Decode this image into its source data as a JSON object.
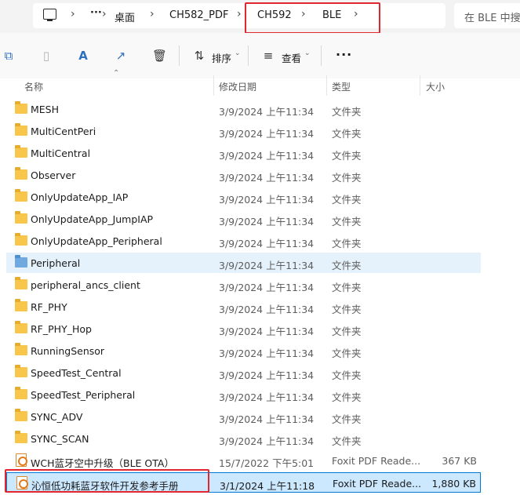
{
  "breadcrumb": {
    "items": [
      "桌面",
      "CH582_PDF",
      "CH592",
      "BLE"
    ],
    "overflow": "···"
  },
  "search": {
    "placeholder": "在 BLE 中搜"
  },
  "toolbar": {
    "sort_label": "排序",
    "view_label": "查看",
    "more_label": "···"
  },
  "columns": {
    "name": "名称",
    "date": "修改日期",
    "type": "类型",
    "size": "大小"
  },
  "files": [
    {
      "name": "MESH",
      "date": "3/9/2024 上午11:34",
      "type": "文件夹",
      "size": "",
      "kind": "folder"
    },
    {
      "name": "MultiCentPeri",
      "date": "3/9/2024 上午11:34",
      "type": "文件夹",
      "size": "",
      "kind": "folder"
    },
    {
      "name": "MultiCentral",
      "date": "3/9/2024 上午11:34",
      "type": "文件夹",
      "size": "",
      "kind": "folder"
    },
    {
      "name": "Observer",
      "date": "3/9/2024 上午11:34",
      "type": "文件夹",
      "size": "",
      "kind": "folder"
    },
    {
      "name": "OnlyUpdateApp_IAP",
      "date": "3/9/2024 上午11:34",
      "type": "文件夹",
      "size": "",
      "kind": "folder"
    },
    {
      "name": "OnlyUpdateApp_JumpIAP",
      "date": "3/9/2024 上午11:34",
      "type": "文件夹",
      "size": "",
      "kind": "folder"
    },
    {
      "name": "OnlyUpdateApp_Peripheral",
      "date": "3/9/2024 上午11:34",
      "type": "文件夹",
      "size": "",
      "kind": "folder"
    },
    {
      "name": "Peripheral",
      "date": "3/9/2024 上午11:34",
      "type": "文件夹",
      "size": "",
      "kind": "folder-blue"
    },
    {
      "name": "peripheral_ancs_client",
      "date": "3/9/2024 上午11:34",
      "type": "文件夹",
      "size": "",
      "kind": "folder"
    },
    {
      "name": "RF_PHY",
      "date": "3/9/2024 上午11:34",
      "type": "文件夹",
      "size": "",
      "kind": "folder"
    },
    {
      "name": "RF_PHY_Hop",
      "date": "3/9/2024 上午11:34",
      "type": "文件夹",
      "size": "",
      "kind": "folder"
    },
    {
      "name": "RunningSensor",
      "date": "3/9/2024 上午11:34",
      "type": "文件夹",
      "size": "",
      "kind": "folder"
    },
    {
      "name": "SpeedTest_Central",
      "date": "3/9/2024 上午11:34",
      "type": "文件夹",
      "size": "",
      "kind": "folder"
    },
    {
      "name": "SpeedTest_Peripheral",
      "date": "3/9/2024 上午11:34",
      "type": "文件夹",
      "size": "",
      "kind": "folder"
    },
    {
      "name": "SYNC_ADV",
      "date": "3/9/2024 上午11:34",
      "type": "文件夹",
      "size": "",
      "kind": "folder"
    },
    {
      "name": "SYNC_SCAN",
      "date": "3/9/2024 上午11:34",
      "type": "文件夹",
      "size": "",
      "kind": "folder"
    },
    {
      "name": "WCH蓝牙空中升级（BLE OTA）",
      "date": "15/7/2022 下午5:01",
      "type": "Foxit PDF Reade...",
      "size": "367 KB",
      "kind": "pdf"
    },
    {
      "name": "沁恒低功耗蓝牙软件开发参考手册",
      "date": "3/1/2024 上午11:18",
      "type": "Foxit PDF Reade...",
      "size": "1,880 KB",
      "kind": "pdf"
    }
  ],
  "state": {
    "hover_row": 7,
    "selected_row": 17
  },
  "colors": {
    "accent": "#0078d4",
    "highlight_box": "#e3262d",
    "folder": "#f7c64a"
  },
  "icons": [
    "computer-icon",
    "copy-icon",
    "paste-icon",
    "rename-icon",
    "share-icon",
    "delete-icon",
    "sort-icon",
    "view-icon",
    "more-icon",
    "folder-icon",
    "pdf-file-icon"
  ]
}
